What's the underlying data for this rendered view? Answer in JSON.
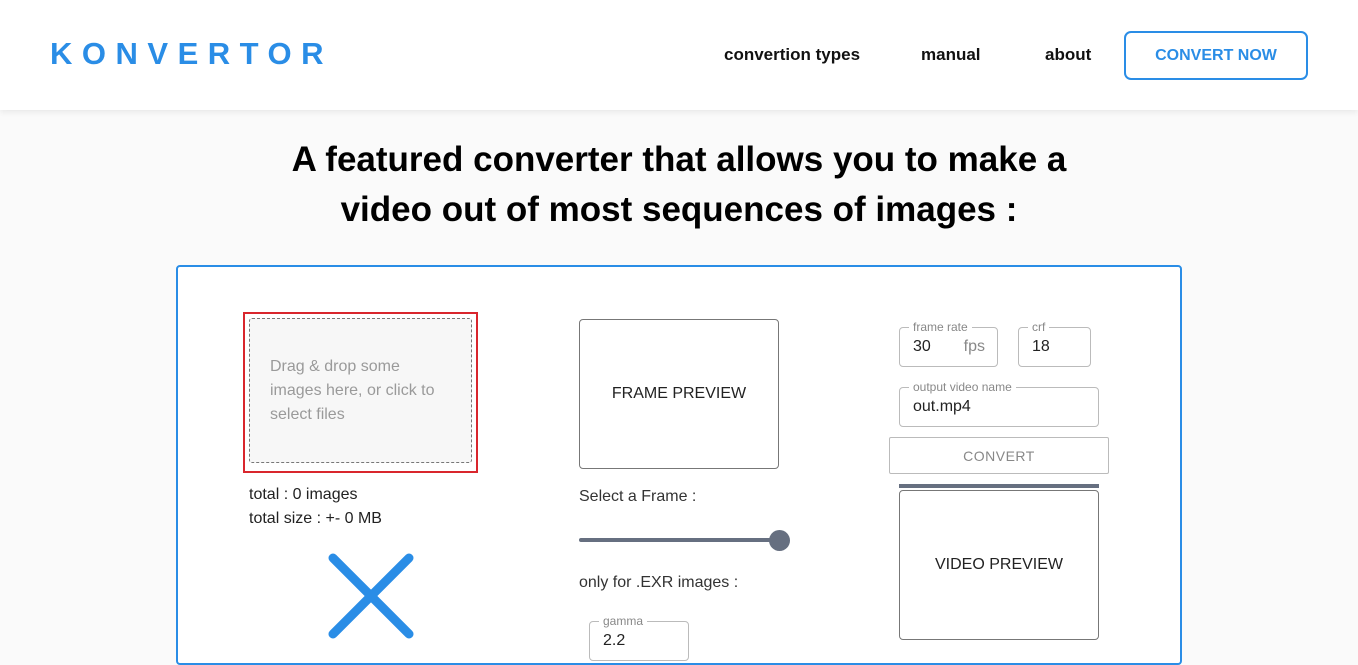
{
  "header": {
    "logo": "KONVERTOR",
    "nav": {
      "conversion_types": "convertion types",
      "manual": "manual",
      "about": "about"
    },
    "cta_label": "CONVERT NOW"
  },
  "headline": {
    "line1": "A featured converter that allows you to make a",
    "line2": "video out of most sequences of images :"
  },
  "upload": {
    "dropzone_text": "Drag & drop some images here, or click to select files",
    "total": "total : 0 images",
    "total_size": "total size : +- 0 MB",
    "clear_icon": "close-icon"
  },
  "frame": {
    "preview_label": "FRAME PREVIEW",
    "select_label": "Select a Frame :",
    "slider_value": 1.0,
    "exr_label": "only for .EXR images :",
    "gamma": {
      "legend": "gamma",
      "value": "2.2"
    }
  },
  "settings": {
    "frame_rate": {
      "legend": "frame rate",
      "value": "30",
      "unit": "fps"
    },
    "crf": {
      "legend": "crf",
      "value": "18"
    },
    "output_name": {
      "legend": "output video name",
      "value": "out.mp4"
    },
    "convert_label": "CONVERT",
    "progress": 1.0,
    "video_preview_label": "VIDEO PREVIEW"
  },
  "colors": {
    "accent": "#2a8de6",
    "dropzone_border": "#d9262d",
    "slider": "#666f80"
  }
}
